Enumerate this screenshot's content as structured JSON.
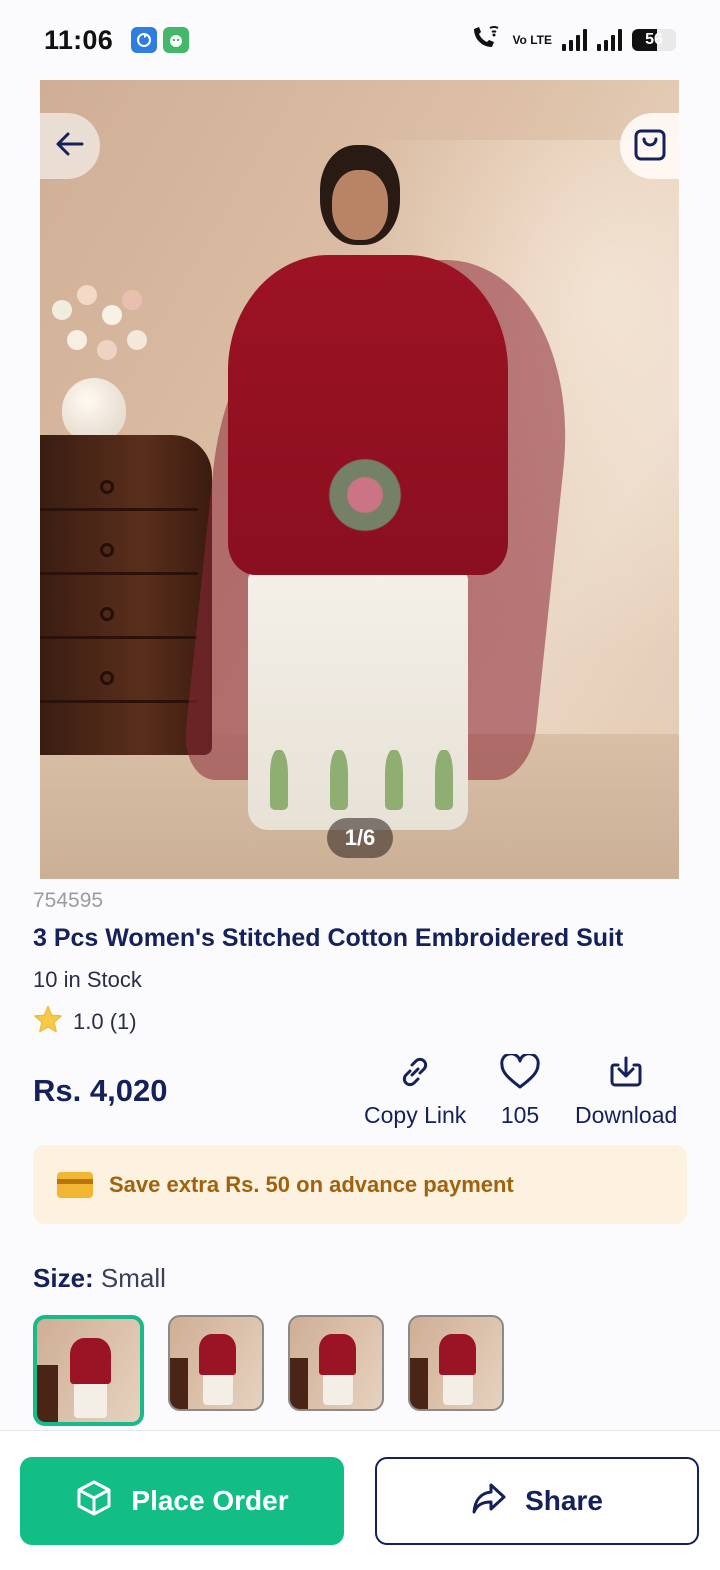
{
  "status_bar": {
    "time": "11:06",
    "battery": "56",
    "battery_level": 0.56,
    "network_label": "Vo LTE"
  },
  "gallery": {
    "counter": "1/6",
    "current_index": 1,
    "total": 6
  },
  "product": {
    "sku": "754595",
    "title": "3 Pcs Women's Stitched Cotton Embroidered Suit",
    "stock": "10 in Stock",
    "rating": "1.0 (1)",
    "price": "Rs. 4,020"
  },
  "actions": {
    "copy_link": "Copy Link",
    "likes": "105",
    "download": "Download"
  },
  "promo": {
    "text": "Save extra Rs. 50 on advance payment"
  },
  "size": {
    "label": "Size:",
    "value": "Small"
  },
  "variants": {
    "count": 4,
    "selected_index": 0
  },
  "bottom_bar": {
    "place_order": "Place Order",
    "share": "Share"
  },
  "colors": {
    "primary_navy": "#14215a",
    "accent_green": "#12be86",
    "promo_bg": "#fdf2df",
    "promo_text": "#a0620f",
    "star": "#f7c948"
  },
  "icons": [
    "arrow-left-icon",
    "shopping-bag-icon",
    "star-icon",
    "link-icon",
    "heart-icon",
    "download-icon",
    "credit-card-icon",
    "package-icon",
    "share-arrow-icon",
    "wifi-call-icon",
    "signal-icon",
    "battery-icon"
  ]
}
